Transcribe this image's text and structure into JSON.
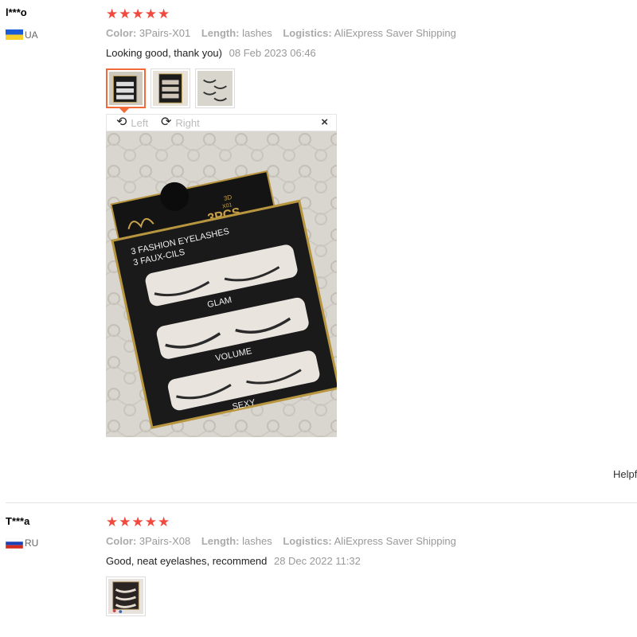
{
  "reviews": [
    {
      "user": "l***o",
      "country": "UA",
      "rating": 5,
      "attributes": [
        {
          "label": "Color:",
          "value": "3Pairs-X01"
        },
        {
          "label": "Length:",
          "value": "lashes"
        },
        {
          "label": "Logistics:",
          "value": "AliExpress Saver Shipping"
        }
      ],
      "comment": "Looking good, thank you)",
      "date": "08 Feb 2023 06:46"
    },
    {
      "user": "T***a",
      "country": "RU",
      "rating": 5,
      "attributes": [
        {
          "label": "Color:",
          "value": "3Pairs-X08"
        },
        {
          "label": "Length:",
          "value": "lashes"
        },
        {
          "label": "Logistics:",
          "value": "AliExpress Saver Shipping"
        }
      ],
      "comment": "Good, neat eyelashes, recommend",
      "date": "28 Dec 2022 11:32"
    }
  ],
  "viewer": {
    "rotate_left": "Left",
    "rotate_right": "Right",
    "close_icon": "×"
  },
  "photo": {
    "box_3d": "3D",
    "box_code": "X01",
    "box_count": "3PCS",
    "line1": "3 FASHION EYELASHES",
    "line2": "3 FAUX-CILS",
    "pair1": "GLAM",
    "pair2": "VOLUME",
    "pair3": "SEXY"
  },
  "helpful_label": "Helpf",
  "colors": {
    "star": "#f04a3e",
    "active_thumb": "#f06a3a"
  }
}
